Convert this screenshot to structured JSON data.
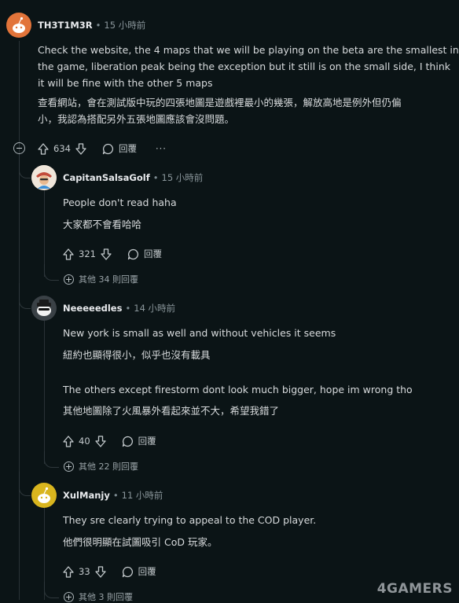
{
  "comments": [
    {
      "author": "TH3T1M3R",
      "time": "15 小時前",
      "lines": [
        "Check the website, the 4 maps that we will be playing on the beta are the smallest in",
        "the game, liberation peak being the exception but it still is on the small side, I think",
        "it will be fine with the other 5 maps"
      ],
      "translation": [
        "查看網站，會在測試版中玩的四張地圖是遊戲裡最小的幾張，解放高地是例外但仍偏",
        "小，我認為搭配另外五張地圖應該會沒問題。"
      ],
      "votes": "634",
      "reply_label": "回覆",
      "more_label": "···"
    },
    {
      "author": "CapitanSalsaGolf",
      "time": "15 小時前",
      "lines": [
        "People don't read haha"
      ],
      "translation": [
        "大家都不會看哈哈"
      ],
      "votes": "321",
      "reply_label": "回覆",
      "expand_label": "其他 34 則回覆"
    },
    {
      "author": "Neeeeedles",
      "time": "14 小時前",
      "lines": [
        "New york is small as well and without vehicles it seems"
      ],
      "translation": [
        "紐約也顯得很小，似乎也沒有載具"
      ],
      "lines2": [
        "The others except firestorm dont look much bigger, hope im wrong tho"
      ],
      "translation2": [
        "其他地圖除了火風暴外看起來並不大，希望我錯了"
      ],
      "votes": "40",
      "reply_label": "回覆",
      "expand_label": "其他 22 則回覆"
    },
    {
      "author": "XulManjy",
      "time": "11 小時前",
      "lines": [
        "They sre clearly trying to appeal to the COD player."
      ],
      "translation": [
        "他們很明顯在試圖吸引 CoD 玩家。"
      ],
      "votes": "33",
      "reply_label": "回覆",
      "expand_label": "其他 3 則回覆"
    }
  ],
  "watermark": "4GAMERS",
  "colors": {
    "background": "#0b1416",
    "text": "#d7dadc",
    "meta": "#8a969b",
    "avatar_orange": "#e2743a",
    "avatar_yellow": "#d9b51e"
  }
}
